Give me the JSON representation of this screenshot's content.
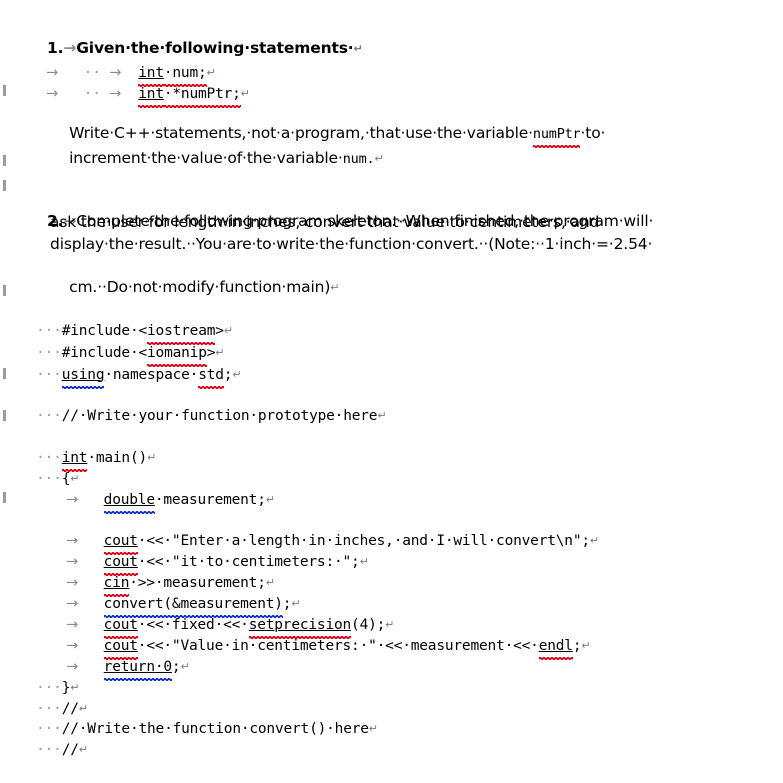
{
  "document": {
    "type": "word-processor-document",
    "formatting_marks_visible": true,
    "marks": {
      "space": "·",
      "tab": "→",
      "paragraph": "↵"
    },
    "colors": {
      "text": "#000000",
      "mark": "#8a8a90",
      "pilcrow": "#6e7b9e",
      "spelling_squiggle": "#e2001a",
      "grammar_squiggle": "#1434d6"
    }
  },
  "questions": [
    {
      "number": "1.",
      "prompt": "Given·the·following·statements·",
      "code_lines": [
        {
          "indent_tabs": 2,
          "text": "int·num;"
        },
        {
          "indent_tabs": 2,
          "text": "int·*numPtr;"
        }
      ],
      "body": {
        "line1_a": "Write·C++·statements,·not·a·program,·that·use·the·variable·",
        "line1_code": "numPtr",
        "line1_b": "·to·",
        "line2_a": "increment·the·value·of·the·variable·",
        "line2_code": "num.",
        "line2_b": ""
      }
    },
    {
      "number": "2.",
      "prompt_lines": [
        "Complete·the·following·program·skeleton.··When·finished,·the·program·will·",
        "ask·the·user·for·length·in·inches,·convert·that·value·to·centimeters,·and·",
        "display·the·result.··You·are·to·write·the·function·convert.··(Note:··1·inch·=·2.54·",
        "cm.··Do·not·modify·function·main)"
      ]
    }
  ],
  "code_block": {
    "lines": [
      {
        "id": "inc-iostream",
        "lead": "···",
        "tab": false,
        "text": "#include·<iostream>",
        "spell": "iostream"
      },
      {
        "id": "inc-iomanip",
        "lead": "···",
        "tab": false,
        "text": "#include·<iomanip>",
        "spell": "iomanip"
      },
      {
        "id": "using-std",
        "lead": "···",
        "tab": false,
        "text": "using·namespace·std;",
        "grammar": "using",
        "spell": "std"
      },
      {
        "id": "blank-1",
        "lead": "",
        "tab": false,
        "text": ""
      },
      {
        "id": "comment-proto",
        "lead": "···",
        "tab": false,
        "text": "//·Write·your·function·prototype·here"
      },
      {
        "id": "blank-2",
        "lead": "",
        "tab": false,
        "text": ""
      },
      {
        "id": "int-main",
        "lead": "···",
        "tab": false,
        "text": "int·main()",
        "spell": "int"
      },
      {
        "id": "open-brace",
        "lead": "···",
        "tab": false,
        "text": "{"
      },
      {
        "id": "decl-double",
        "lead": "",
        "tab": true,
        "text": "double·measurement;",
        "grammar": "double"
      },
      {
        "id": "blank-3",
        "lead": "",
        "tab": false,
        "text": ""
      },
      {
        "id": "cout-prompt1",
        "lead": "",
        "tab": true,
        "text": "cout·<<·\"Enter·a·length·in·inches,·and·I·will·convert\\n\";",
        "spell": "cout"
      },
      {
        "id": "cout-prompt2",
        "lead": "",
        "tab": true,
        "text": "cout·<<·\"it·to·centimeters:·\";",
        "spell": "cout"
      },
      {
        "id": "cin-read",
        "lead": "",
        "tab": true,
        "text": "cin·>>·measurement;",
        "spell": "cin"
      },
      {
        "id": "call-convert",
        "lead": "",
        "tab": true,
        "text": "convert(&measurement);",
        "grammar": "convert(&measurement)"
      },
      {
        "id": "cout-fixed",
        "lead": "",
        "tab": true,
        "text": "cout·<<·fixed·<<·setprecision(4);",
        "spell": "cout"
      },
      {
        "id": "cout-result",
        "lead": "",
        "tab": true,
        "text": "cout·<<·\"Value·in·centimeters:·\"·<<·measurement·<<·endl;",
        "spell": "cout"
      },
      {
        "id": "return-zero",
        "lead": "",
        "tab": true,
        "text": "return·0;",
        "grammar": "return·0"
      },
      {
        "id": "close-brace",
        "lead": "···",
        "tab": false,
        "text": "}"
      },
      {
        "id": "comment-rule1",
        "lead": "···",
        "tab": false,
        "text": "//"
      },
      {
        "id": "comment-write",
        "lead": "···",
        "tab": false,
        "text": "//·Write·the·function·convert()·here"
      },
      {
        "id": "comment-rule2",
        "lead": "···",
        "tab": false,
        "text": "//"
      }
    ]
  },
  "fragments": {
    "q1_tab_lead": "→",
    "q1_tab_mid": "··",
    "q1_tab_mid2": "→",
    "int_kw": "int",
    "rest_num": "·num;",
    "rest_numptr": "·*numPtr;",
    "numptr_word": "numPtr",
    "iostream_pre": "#include·<",
    "iostream_word": "iostream",
    "iostream_post": ">",
    "iomanip_pre": "#include·<",
    "iomanip_word": "iomanip",
    "iomanip_post": ">",
    "using_word": "using",
    "using_mid": "·namespace·",
    "std_word": "std",
    "using_post": ";",
    "comment_proto": "//·Write·your·function·prototype·here",
    "int_main_rest": "·main()",
    "open_brace": "{",
    "double_word": "double",
    "double_rest": "·measurement;",
    "cout_word": "cout",
    "cout1_rest": "·<<·\"Enter·a·length·in·inches,·and·I·will·convert\\n\";",
    "cout2_rest": "·<<·\"it·to·centimeters:·\";",
    "cin_word": "cin",
    "cin_rest": "·>>·measurement;",
    "convert_call": "convert(&measurement)",
    "convert_rest": ";",
    "cout3_mid": "·<<·fixed·<<·",
    "setprecision_word": "setprecision",
    "setprecision_rest": "(4);",
    "cout4_rest": "·<<·\"Value·in·centimeters:·\"·<<·measurement·<<·",
    "endl_word": "endl",
    "endl_rest": ";",
    "return_word": "return·0",
    "return_rest": ";",
    "close_brace": "}",
    "slash_comment": "//",
    "comment_convert": "//·Write·the·function·convert()·here",
    "lead3": "···",
    "tabarrow": "→",
    "pilcrow": "↵"
  }
}
